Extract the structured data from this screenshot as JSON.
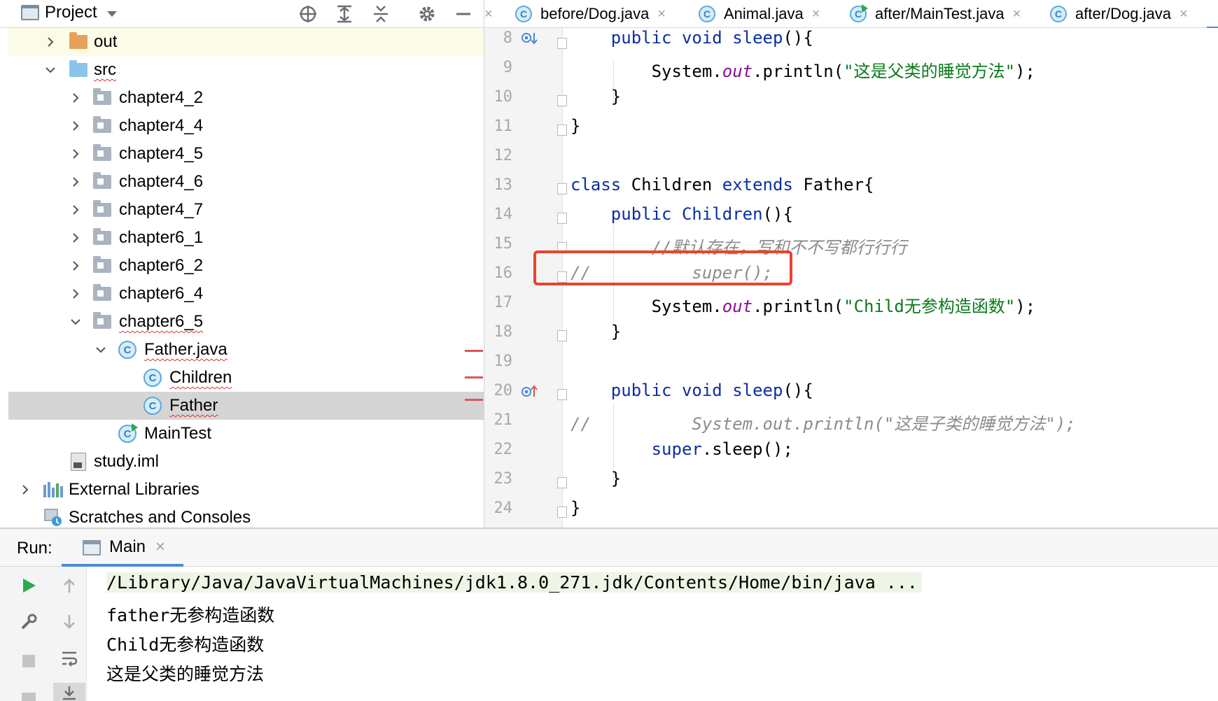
{
  "project_panel": {
    "title": "Project",
    "tree": [
      {
        "label": "out",
        "icon": "folder-orange-icon",
        "expanded": false
      },
      {
        "label": "src",
        "icon": "folder-blue-icon",
        "expanded": true
      },
      {
        "label": "chapter4_2",
        "icon": "package-icon",
        "expanded": false
      },
      {
        "label": "chapter4_4",
        "icon": "package-icon",
        "expanded": false
      },
      {
        "label": "chapter4_5",
        "icon": "package-icon",
        "expanded": false
      },
      {
        "label": "chapter4_6",
        "icon": "package-icon",
        "expanded": false
      },
      {
        "label": "chapter4_7",
        "icon": "package-icon",
        "expanded": false
      },
      {
        "label": "chapter6_1",
        "icon": "package-icon",
        "expanded": false
      },
      {
        "label": "chapter6_2",
        "icon": "package-icon",
        "expanded": false
      },
      {
        "label": "chapter6_4",
        "icon": "package-icon",
        "expanded": false
      },
      {
        "label": "chapter6_5",
        "icon": "package-icon",
        "expanded": true
      },
      {
        "label": "Father.java",
        "icon": "class-file-icon",
        "expanded": true
      },
      {
        "label": "Children",
        "icon": "class-icon"
      },
      {
        "label": "Father",
        "icon": "class-icon",
        "selected": true
      },
      {
        "label": "MainTest",
        "icon": "runnable-class-icon"
      },
      {
        "label": "study.iml",
        "icon": "module-file-icon"
      },
      {
        "label": "External Libraries",
        "icon": "libraries-icon",
        "expanded": false
      },
      {
        "label": "Scratches and Consoles",
        "icon": "scratches-icon"
      }
    ],
    "class_letter": "C"
  },
  "tabs": [
    {
      "label": "before/Dog.java"
    },
    {
      "label": "Animal.java"
    },
    {
      "label": "after/MainTest.java"
    },
    {
      "label": "after/Dog.java"
    }
  ],
  "tab_close_glyph": "×",
  "editor": {
    "line_numbers": [
      "8",
      "9",
      "10",
      "11",
      "12",
      "13",
      "14",
      "15",
      "16",
      "17",
      "18",
      "19",
      "20",
      "21",
      "22",
      "23",
      "24"
    ],
    "lines": [
      "    public void sleep(){",
      "        System.out.println(\"这是父类的睡觉方法\");",
      "    }",
      "}",
      "",
      "class Children extends Father{",
      "    public Children(){",
      "        //默认存在，写和不不写都行行行",
      "//          super();",
      "        System.out.println(\"Child无参构造函数\");",
      "    }",
      "",
      "    public void sleep(){",
      "//          System.out.println(\"这是子类的睡觉方法\");",
      "        super.sleep();",
      "    }",
      "}"
    ]
  },
  "run_panel": {
    "label": "Run:",
    "tab": "Main",
    "output": [
      "/Library/Java/JavaVirtualMachines/jdk1.8.0_271.jdk/Contents/Home/bin/java ...",
      "father无参构造函数",
      "Child无参构造函数",
      "这是父类的睡觉方法"
    ]
  },
  "colors": {
    "keyword": "#0b2fa0",
    "string": "#0a7a1d",
    "comment": "#8c8c8c",
    "static_field": "#871094",
    "highlight_box": "#e8442f",
    "selection": "#d5d5d5",
    "accent": "#4a8bd6"
  }
}
